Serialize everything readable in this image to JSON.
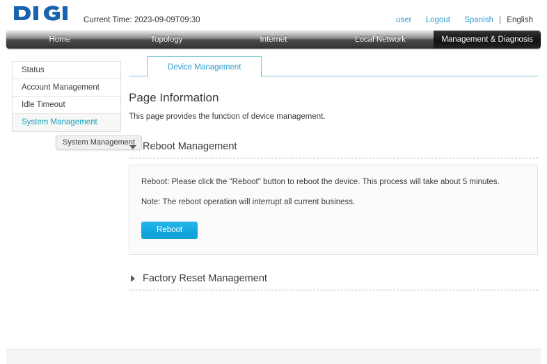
{
  "header": {
    "logo_text": "DIGI",
    "logo_color": "#1763b0",
    "current_time": "Current Time: 2023-09-09T09:30",
    "links": {
      "user": "user",
      "logout": "Logout",
      "spanish": "Spanish",
      "separator": "|",
      "english": "English"
    }
  },
  "nav": {
    "items": [
      {
        "label": "Home",
        "active": false
      },
      {
        "label": "Topology",
        "active": false
      },
      {
        "label": "Internet",
        "active": false
      },
      {
        "label": "Local Network",
        "active": false
      },
      {
        "label": "Management & Diagnosis",
        "active": true
      }
    ]
  },
  "sidebar": {
    "items": [
      {
        "label": "Status",
        "active": false
      },
      {
        "label": "Account Management",
        "active": false
      },
      {
        "label": "Idle Timeout",
        "active": false
      },
      {
        "label": "System Management",
        "active": true
      }
    ],
    "tooltip": "System Management"
  },
  "content": {
    "tabs": [
      {
        "label": "Device Management",
        "active": true
      }
    ],
    "page_title": "Page Information",
    "page_description": "This page provides the function of device management.",
    "sections": [
      {
        "title": "Reboot Management",
        "expanded": true,
        "lines": [
          "Reboot: Please click the \"Reboot\" button to reboot the device. This process will take about 5 minutes.",
          "Note: The reboot operation will interrupt all current business."
        ],
        "button_label": "Reboot"
      },
      {
        "title": "Factory Reset Management",
        "expanded": false
      }
    ]
  },
  "colors": {
    "accent_blue": "#2f9fd0",
    "accent_teal": "#17a2bd",
    "button_blue": "#11a8e0",
    "logo_blue": "#1763b0",
    "nav_dark": "#2e2e2e"
  }
}
